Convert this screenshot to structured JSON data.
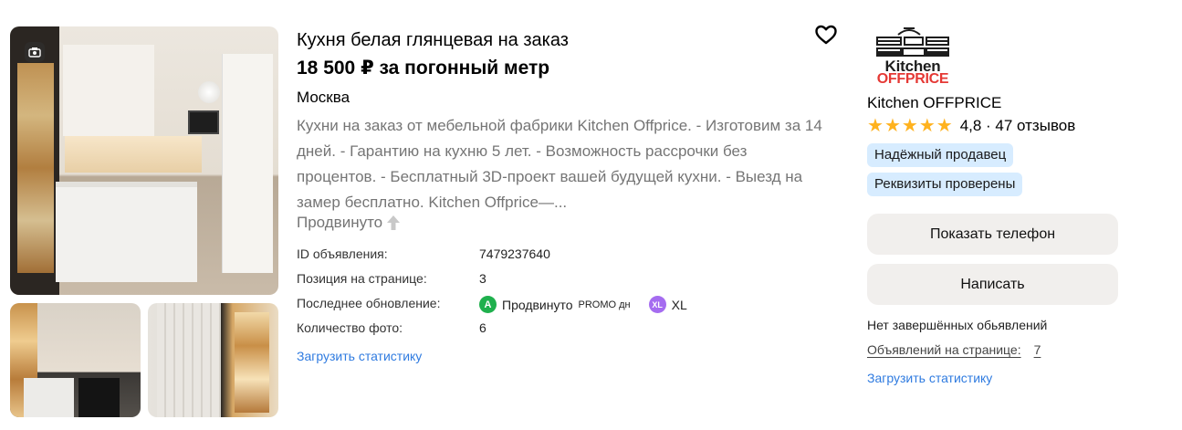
{
  "listing": {
    "title": "Кухня белая глянцевая на заказ",
    "price": "18 500 ₽ за погонный метр",
    "city": "Москва",
    "description": "Кухни на заказ от мебельной фабрики Kitchen Offprice. - Изготовим за 14 дней. - Гарантию на кухню 5 лет. - Возможность рассрочки без процентов. - Бесплатный 3D-проект вашей будущей кухни. - Выезд на замер бесплатно. Kitchen Offprice—...",
    "promoted_label": "Продвинуто",
    "favorite_icon": "heart-outline-icon",
    "photo_badge_icon": "camera-icon"
  },
  "meta": {
    "id_label": "ID объявления:",
    "id_value": "7479237640",
    "position_label": "Позиция на странице:",
    "position_value": "3",
    "updated_label": "Последнее обновление:",
    "updated_badge_a": "A",
    "updated_promo": "Продвинуто",
    "updated_promo_tag": "PROMO дн",
    "updated_badge_xl": "XL",
    "updated_xl": "XL",
    "photos_label": "Количество фото:",
    "photos_value": "6",
    "load_stats": "Загрузить статистику"
  },
  "seller": {
    "logo_word_1": "Kitchen",
    "logo_word_2": "OFFPRICE",
    "name": "Kitchen OFFPRICE",
    "rating": "4,8 · 47 отзывов",
    "rating_stars": 5,
    "badge_reliable": "Надёжный продавец",
    "badge_verified": "Реквизиты проверены",
    "show_phone": "Показать телефон",
    "write": "Написать",
    "no_completed": "Нет завершённых обьявлений",
    "ads_on_page_label": "Объявлений на странице:",
    "ads_on_page_value": "7",
    "load_stats": "Загрузить статистику"
  },
  "colors": {
    "link": "#2f7be0",
    "star": "#ffb21e",
    "badge_bg": "#d7ecff",
    "button_bg": "#f1efed",
    "promo_a": "#1fb04d",
    "promo_xl": "#a56cf0",
    "logo_red": "#e53935"
  }
}
